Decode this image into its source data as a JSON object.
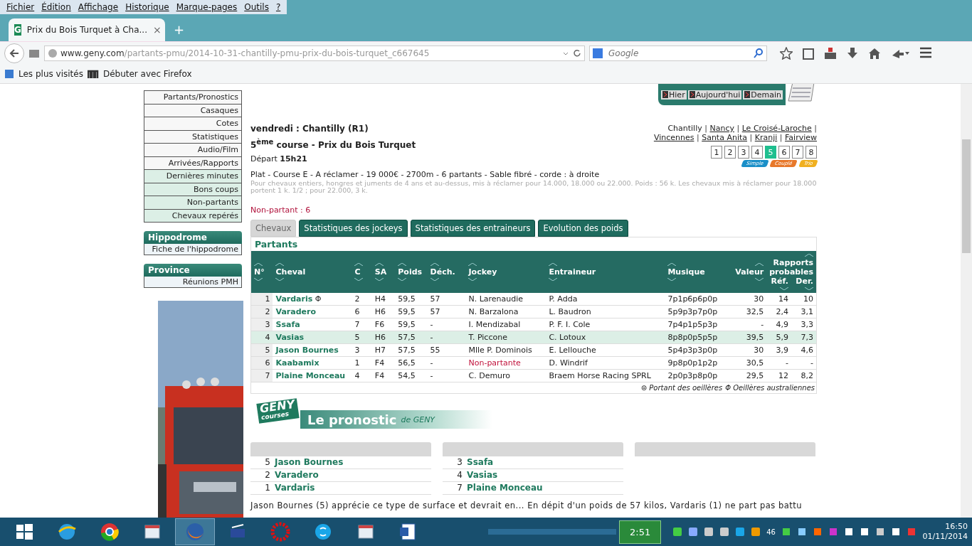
{
  "menu_bar": [
    "Fichier",
    "Édition",
    "Affichage",
    "Historique",
    "Marque-pages",
    "Outils",
    "?"
  ],
  "browser_tab": {
    "title": "Prix du Bois Turquet à Cha...",
    "close": "×",
    "favicon": "G"
  },
  "new_tab": "+",
  "address_bar": {
    "host": "www.geny.com",
    "path": "/partants-pmu/2014-10-31-chantilly-pmu-prix-du-bois-turquet_c667645"
  },
  "search_field": {
    "placeholder": "Google"
  },
  "bookmarks": [
    "Les plus visités",
    "Débuter avec Firefox"
  ],
  "sidebar": {
    "menu": [
      {
        "label": "Partants/Pronostics",
        "highlighted": false
      },
      {
        "label": "Casaques",
        "highlighted": false
      },
      {
        "label": "Cotes",
        "highlighted": false
      },
      {
        "label": "Statistiques",
        "highlighted": false
      },
      {
        "label": "Audio/Film",
        "highlighted": false
      },
      {
        "label": "Arrivées/Rapports",
        "highlighted": false
      },
      {
        "label": "Dernières minutes",
        "highlighted": true
      },
      {
        "label": "Bons coups",
        "highlighted": true
      },
      {
        "label": "Non-partants",
        "highlighted": true
      },
      {
        "label": "Chevaux repérés",
        "highlighted": true
      }
    ],
    "sections": [
      {
        "title": "Hippodrome",
        "items": [
          "Fiche de l'hippodrome"
        ]
      },
      {
        "title": "Province",
        "items": [
          "Réunions PMH"
        ]
      }
    ]
  },
  "day_nav": [
    "Hier",
    "Aujourd'hui",
    "Demain"
  ],
  "race": {
    "meeting": "vendredi :  Chantilly (R1)",
    "course": "5$^{ème}$ course - Prix du Bois Turquet",
    "departure": "Départ **15h21**",
    "conditions": "Plat - Course E - A réclamer - 19 000€ - 2700m - 6 partants - Sable fibré - corde : à droite",
    "details": "Pour chevaux entiers, hongres et juments de 4 ans et au-dessus, mis à réclamer pour 14.000, 18.000 ou 22.000. Poids : 56 k. Les chevaux mis à réclamer pour 18.000 portent 1 k. 1/2 ; pour 22.000, 3 k.",
    "non_runner": "Non-partant : 6"
  },
  "hippodromes": [
    {
      "label": "Chantilly",
      "link": false,
      "separator": "|"
    },
    {
      "label": "Nancy",
      "link": true,
      "separator": "|"
    },
    {
      "label": "Le Croisé-Laroche",
      "link": true,
      "separator": "|"
    },
    {
      "label": "Vincennes",
      "link": true,
      "separator": "|"
    },
    {
      "label": "Santa Anita",
      "link": true,
      "separator": "|"
    },
    {
      "label": "Kranji",
      "link": true,
      "separator": "|"
    },
    {
      "label": "Fairview",
      "link": true
    }
  ],
  "race_numbers": [
    {
      "label": "1",
      "selected": false
    },
    {
      "label": "2",
      "selected": false
    },
    {
      "label": "3",
      "selected": false
    },
    {
      "label": "4",
      "selected": false
    },
    {
      "label": "5",
      "selected": true
    },
    {
      "label": "6",
      "selected": false
    },
    {
      "label": "7",
      "selected": false
    },
    {
      "label": "8",
      "selected": false
    }
  ],
  "bet_badges": [
    {
      "label": "Simple",
      "color": "#1a8fc8"
    },
    {
      "label": "Couplé",
      "color": "#e8782a"
    },
    {
      "label": "Trio",
      "color": "#f0b020"
    }
  ],
  "tabs": [
    {
      "label": "Chevaux",
      "selected": true
    },
    {
      "label": "Statistiques des jockeys",
      "selected": false
    },
    {
      "label": "Statistiques des entraineurs",
      "selected": false
    },
    {
      "label": "Evolution des poids",
      "selected": false
    }
  ],
  "table": {
    "title": "Partants",
    "columns": [
      "N°",
      "Cheval",
      "C",
      "SA",
      "Poids",
      "Déch.",
      "Jockey",
      "Entraineur",
      "Musique",
      "Valeur"
    ],
    "group_header": "Rapports probables",
    "group_columns": [
      "Réf.",
      "Der."
    ],
    "rows": [
      {
        "cells": [
          "1",
          "Vardaris",
          "2",
          "H4",
          "59,5",
          "57",
          "N. Larenaudie",
          "P. Adda",
          "7p1p6p6p0p",
          "30",
          "14",
          "10"
        ],
        "mark": "Φ",
        "highlighted": false,
        "non_runner": false
      },
      {
        "cells": [
          "2",
          "Varadero",
          "6",
          "H6",
          "59,5",
          "57",
          "N. Barzalona",
          "L. Baudron",
          "5p9p3p7p0p",
          "32,5",
          "2,4",
          "3,1"
        ],
        "highlighted": false,
        "non_runner": false
      },
      {
        "cells": [
          "3",
          "Ssafa",
          "7",
          "F6",
          "59,5",
          "-",
          "I. Mendizabal",
          "P. F. I. Cole",
          "7p4p1p5p3p",
          "-",
          "4,9",
          "3,3"
        ],
        "highlighted": false,
        "non_runner": false
      },
      {
        "cells": [
          "4",
          "Vasias",
          "5",
          "H6",
          "57,5",
          "-",
          "T. Piccone",
          "C. Lotoux",
          "8p8p0p5p5p",
          "39,5",
          "5,9",
          "7,3"
        ],
        "highlighted": true,
        "non_runner": false
      },
      {
        "cells": [
          "5",
          "Jason Bournes",
          "3",
          "H7",
          "57,5",
          "55",
          "Mlle P. Dominois",
          "E. Lellouche",
          "5p4p3p3p0p",
          "30",
          "3,9",
          "4,6"
        ],
        "highlighted": false,
        "non_runner": false
      },
      {
        "cells": [
          "6",
          "Kaabamix",
          "1",
          "F4",
          "56,5",
          "-",
          "Non-partante",
          "D. Windrif",
          "9p8p0p1p2p",
          "30,5",
          "-",
          "-"
        ],
        "highlighted": false,
        "non_runner": true
      },
      {
        "cells": [
          "7",
          "Plaine Monceau",
          "4",
          "F4",
          "54,5",
          "-",
          "C. Demuro",
          "Braem Horse Racing SPRL",
          "2p0p3p8p0p",
          "29,5",
          "12",
          "8,2"
        ],
        "highlighted": false,
        "non_runner": false
      }
    ],
    "legend": [
      "⊜ Portant des oeillères",
      "Φ Oeillères australiennes"
    ]
  },
  "pronostic": {
    "logo": [
      "GENY",
      "courses"
    ],
    "title": "Le pronostic",
    "by": "de GENY",
    "columns": [
      {
        "entries": [
          {
            "number": "5",
            "name": "Jason Bournes"
          },
          {
            "number": "2",
            "name": "Varadero"
          },
          {
            "number": "1",
            "name": "Vardaris"
          }
        ]
      },
      {
        "entries": [
          {
            "number": "3",
            "name": "Ssafa"
          },
          {
            "number": "4",
            "name": "Vasias"
          },
          {
            "number": "7",
            "name": "Plaine Monceau"
          }
        ]
      },
      {}
    ],
    "summary": "Jason Bournes (5) apprécie ce type de surface et devrait en... En dépit d'un poids de 57 kilos, Vardaris (1) ne part pas battu"
  },
  "taskbar": {
    "badge": "2:51",
    "tray_count": "46",
    "time": "16:50",
    "date": "01/11/2014"
  }
}
